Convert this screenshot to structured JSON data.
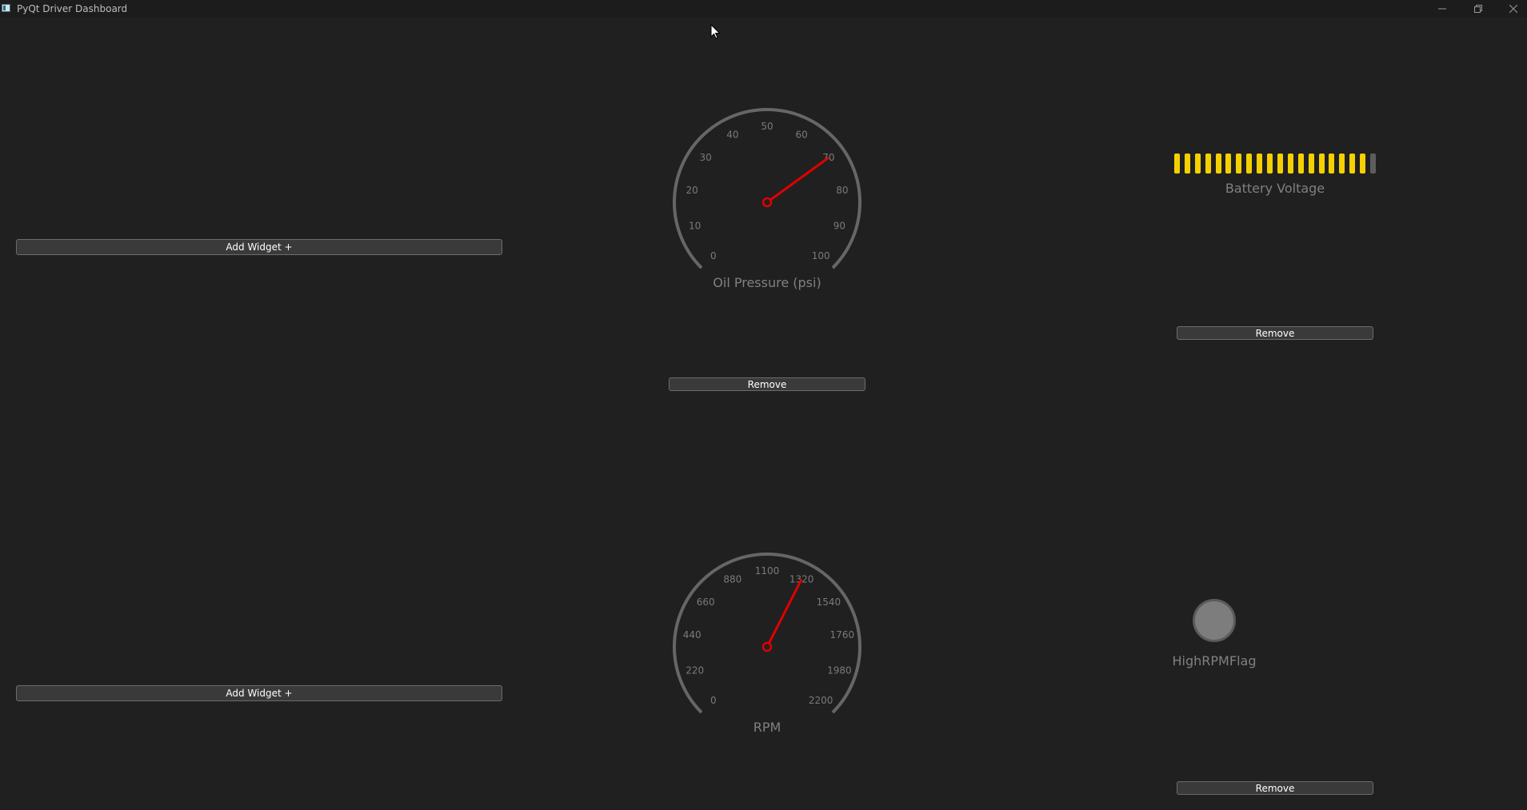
{
  "window": {
    "title": "PyQt Driver Dashboard",
    "icons": {
      "app": "app-icon",
      "minimize": "minimize-icon",
      "maximize": "maximize-icon",
      "close": "close-icon"
    }
  },
  "buttons": {
    "add_widget": "Add Widget +",
    "remove": "Remove"
  },
  "oil_pressure": {
    "label": "Oil Pressure (psi)",
    "ticks": [
      "0",
      "10",
      "20",
      "30",
      "40",
      "50",
      "60",
      "70",
      "80",
      "90",
      "100"
    ],
    "min": 0,
    "max": 100,
    "value": 70
  },
  "rpm": {
    "label": "RPM",
    "ticks": [
      "0",
      "220",
      "440",
      "660",
      "880",
      "1100",
      "1320",
      "1540",
      "1760",
      "1980",
      "2200"
    ],
    "min": 0,
    "max": 2200,
    "value": 1320
  },
  "battery": {
    "label": "Battery Voltage",
    "segments_total": 20,
    "segments_lit": 19
  },
  "indicator": {
    "label": "HighRPMFlag",
    "state": "off"
  },
  "colors": {
    "background": "#202020",
    "gauge_arc": "#666666",
    "needle": "#e00000",
    "battery_on": "#f4d000",
    "battery_off": "#5d5d5d",
    "lamp_off": "#7d7d7d"
  }
}
